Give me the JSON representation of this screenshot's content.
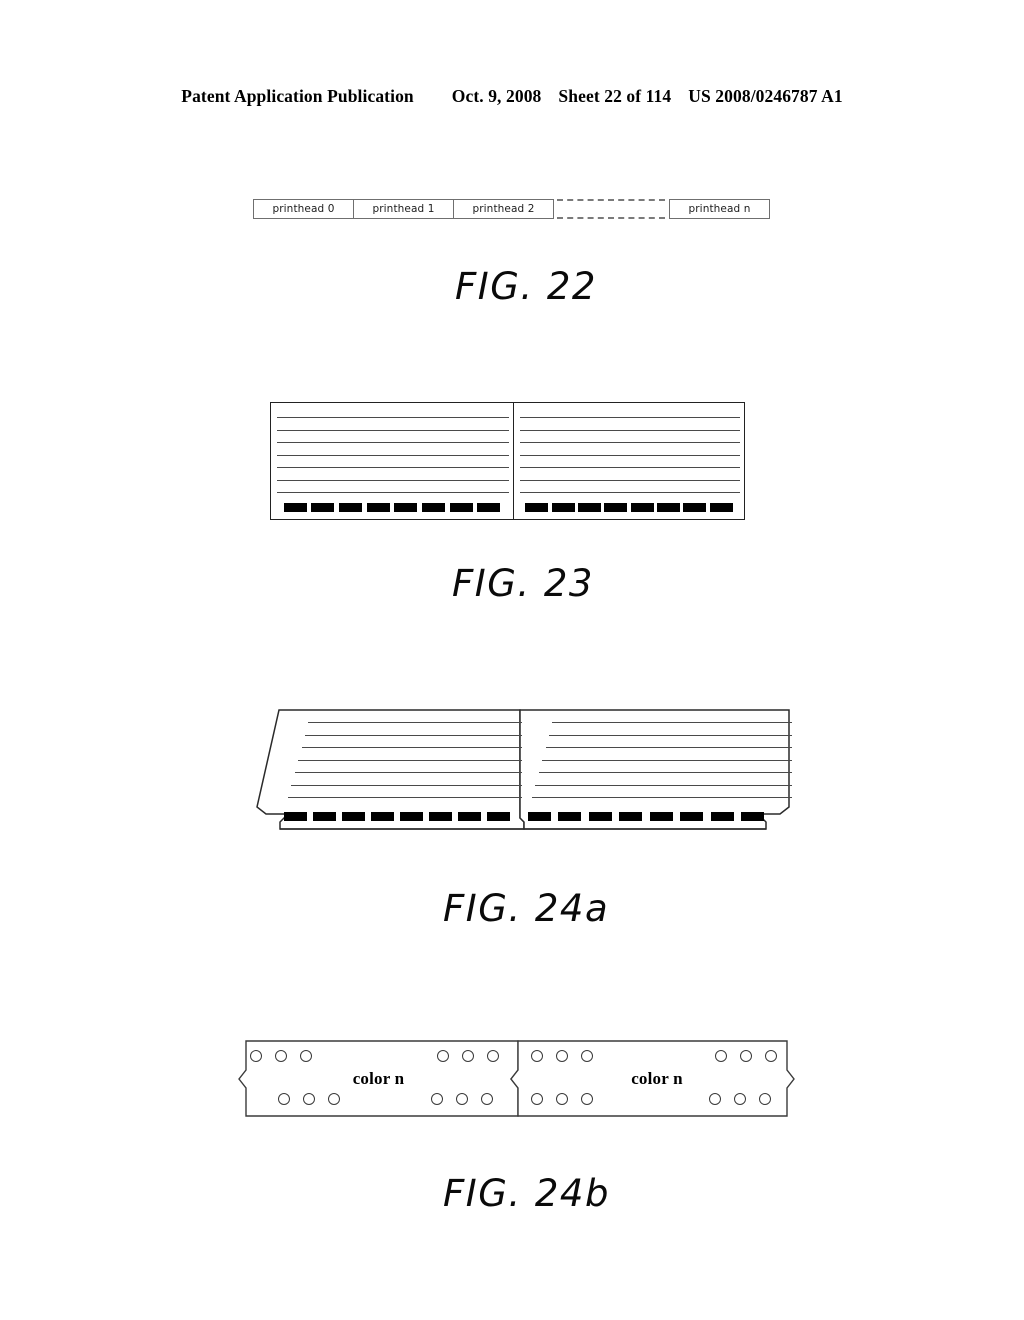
{
  "header": {
    "publication": "Patent Application Publication",
    "date": "Oct. 9, 2008",
    "sheet": "Sheet 22 of 114",
    "patent_number": "US 2008/0246787 A1"
  },
  "figures": [
    {
      "id": "fig22",
      "label": "FIG. 22",
      "type": "printhead-linear-array",
      "boxes": [
        {
          "label": "printhead 0"
        },
        {
          "label": "printhead 1"
        },
        {
          "label": "printhead 2"
        },
        {
          "label": "printhead n"
        }
      ],
      "ellipsis_dashes": 4
    },
    {
      "id": "fig23",
      "label": "FIG. 23",
      "type": "rectangular-printhead-pair",
      "panels": [
        {
          "hlines": 7,
          "nozzles": 8
        },
        {
          "hlines": 7,
          "nozzles": 8
        }
      ]
    },
    {
      "id": "fig24a",
      "label": "FIG. 24a",
      "type": "slanted-printhead-pair",
      "panels": [
        {
          "hlines": 7,
          "nozzles": 8
        },
        {
          "hlines": 7,
          "nozzles": 8
        }
      ]
    },
    {
      "id": "fig24b",
      "label": "FIG. 24b",
      "type": "notched-printhead-pair-with-holes",
      "panels": [
        {
          "label": "color n",
          "hole_groups": 4,
          "holes_per_group": 3
        },
        {
          "label": "color n",
          "hole_groups": 4,
          "holes_per_group": 3
        }
      ]
    }
  ],
  "colors": {
    "ink": "#000000",
    "line": "#4a4a4a",
    "outline": "#222222",
    "box_border": "#6f6f6f",
    "paper": "#ffffff"
  }
}
